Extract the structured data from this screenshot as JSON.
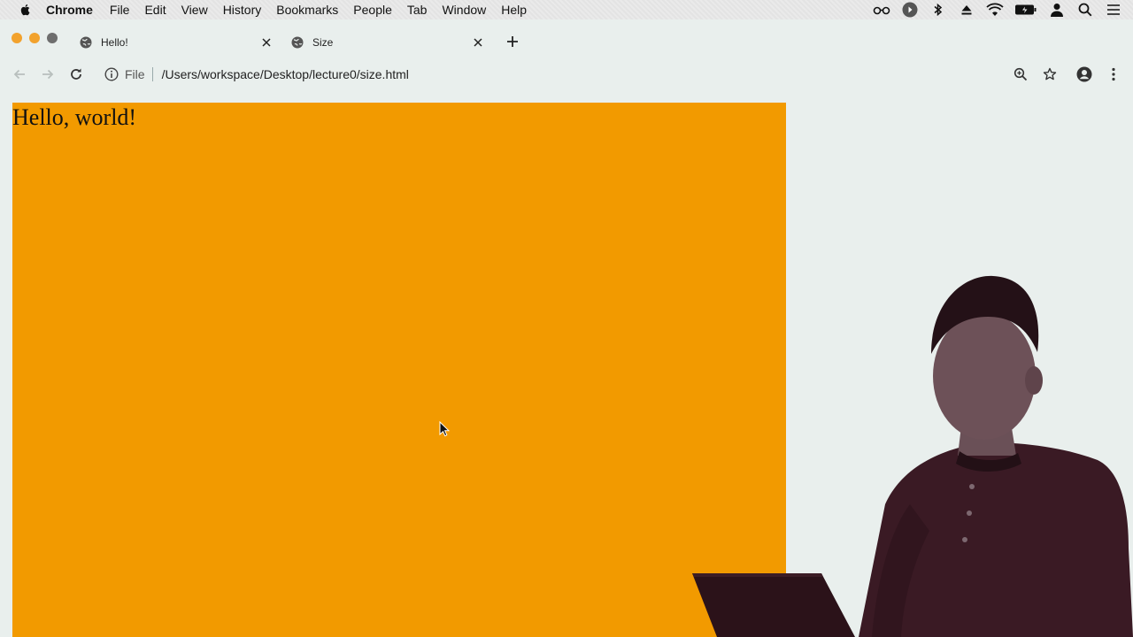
{
  "menubar": {
    "app_name": "Chrome",
    "items": [
      "File",
      "Edit",
      "View",
      "History",
      "Bookmarks",
      "People",
      "Tab",
      "Window",
      "Help"
    ],
    "status_icons": [
      "glasses-icon",
      "play-circle-icon",
      "bluetooth-icon",
      "eject-icon",
      "wifi-icon",
      "battery-icon",
      "user-icon",
      "spotlight-search-icon",
      "notification-list-icon"
    ]
  },
  "tabs": [
    {
      "title": "Hello!",
      "active": true
    },
    {
      "title": "Size",
      "active": false
    }
  ],
  "toolbar": {
    "url_scheme": "File",
    "url_path": "/Users/workspace/Desktop/lecture0/size.html"
  },
  "page": {
    "heading": "Hello, world!",
    "box_color": "#f29a00"
  },
  "colors": {
    "chrome_bg": "#e9efed",
    "accent_orange": "#f29a00"
  }
}
